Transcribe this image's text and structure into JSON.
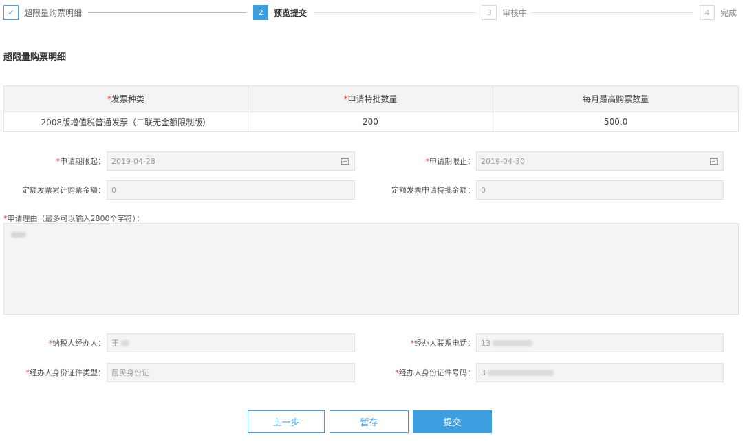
{
  "stepper": {
    "steps": [
      {
        "number": "✓",
        "label": "超限量购票明细",
        "state": "done"
      },
      {
        "number": "2",
        "label": "预览提交",
        "state": "active"
      },
      {
        "number": "3",
        "label": "审核中",
        "state": "pending"
      },
      {
        "number": "4",
        "label": "完成",
        "state": "pending"
      }
    ]
  },
  "section_title": "超限量购票明细",
  "table": {
    "headers": [
      {
        "required": "*",
        "label": "发票种类"
      },
      {
        "required": "*",
        "label": "申请特批数量"
      },
      {
        "required": "",
        "label": "每月最高购票数量"
      }
    ],
    "rows": [
      [
        "2008版增值税普通发票（二联无金额限制版）",
        "200",
        "500.0"
      ]
    ]
  },
  "form": {
    "apply_start": {
      "required": "*",
      "label": "申请期限起：",
      "value": "2019-04-28"
    },
    "apply_end": {
      "required": "*",
      "label": "申请期限止：",
      "value": "2019-04-30"
    },
    "quota_total": {
      "required": "",
      "label": "定额发票累计购票金额：",
      "value": "0"
    },
    "quota_special": {
      "required": "",
      "label": "定额发票申请特批金额：",
      "value": "0"
    },
    "reason": {
      "required": "*",
      "label": "申请理由（最多可以输入2800个字符）："
    },
    "handler": {
      "required": "*",
      "label": "纳税人经办人：",
      "value": "王"
    },
    "phone": {
      "required": "*",
      "label": "经办人联系电话：",
      "value": "13"
    },
    "id_type": {
      "required": "*",
      "label": "经办人身份证件类型：",
      "value": "居民身份证"
    },
    "id_number": {
      "required": "*",
      "label": "经办人身份证件号码：",
      "value": "3"
    }
  },
  "buttons": {
    "prev": "上一步",
    "save": "暂存",
    "submit": "提交"
  },
  "colors": {
    "accent": "#3d9ee0",
    "required": "#ee3333",
    "input_bg": "#f4f4f4"
  },
  "icons": {
    "done_step": "checkmark-icon",
    "date_picker": "calendar-icon"
  }
}
